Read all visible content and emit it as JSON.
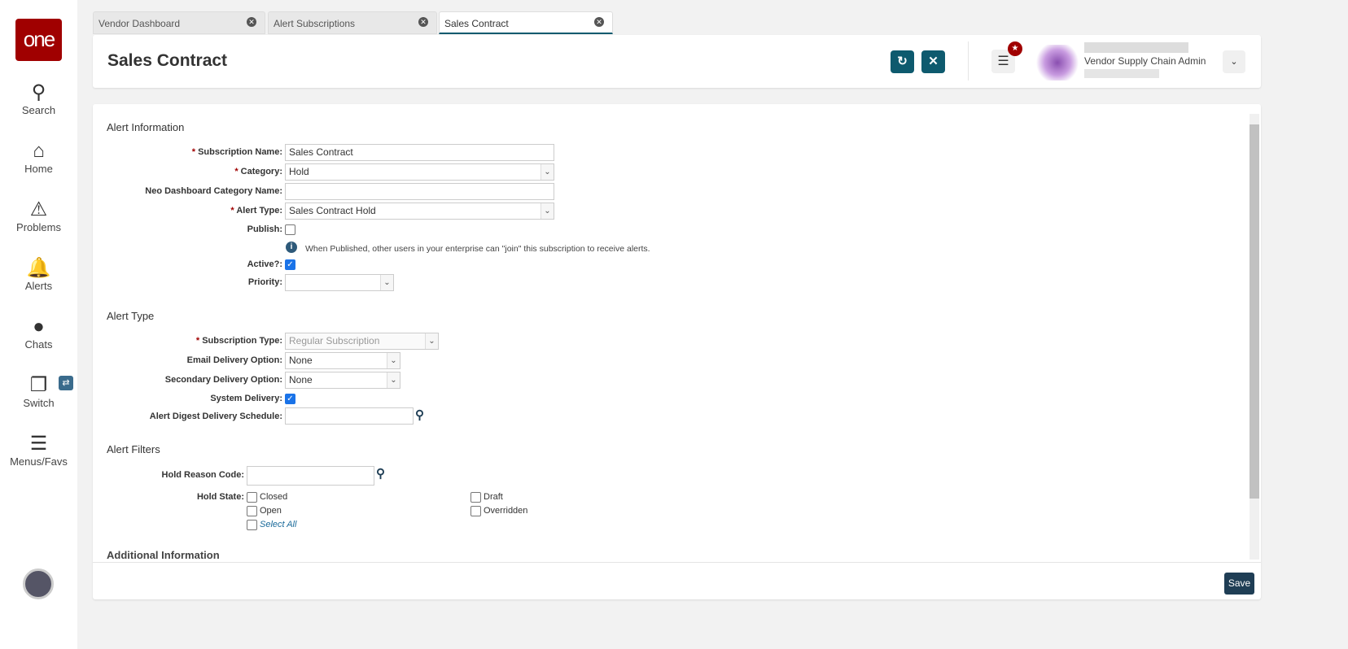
{
  "sidebar": {
    "logo": "one",
    "items": [
      {
        "label": "Search",
        "icon": "search-icon"
      },
      {
        "label": "Home",
        "icon": "home-icon"
      },
      {
        "label": "Problems",
        "icon": "warning-icon"
      },
      {
        "label": "Alerts",
        "icon": "bell-icon"
      },
      {
        "label": "Chats",
        "icon": "chat-icon"
      },
      {
        "label": "Switch",
        "icon": "switch-icon"
      },
      {
        "label": "Menus/Favs",
        "icon": "menu-icon"
      }
    ]
  },
  "tabs": [
    {
      "label": "Vendor Dashboard"
    },
    {
      "label": "Alert Subscriptions"
    },
    {
      "label": "Sales Contract",
      "active": true
    }
  ],
  "header": {
    "title": "Sales Contract",
    "user_role": "Vendor Supply Chain Admin"
  },
  "sections": {
    "alert_info": "Alert Information",
    "alert_type": "Alert Type",
    "alert_filters": "Alert Filters",
    "additional": "Additional Information"
  },
  "form": {
    "subscription_name": {
      "label": "Subscription Name:",
      "value": "Sales Contract"
    },
    "category": {
      "label": "Category:",
      "value": "Hold"
    },
    "neo_category": {
      "label": "Neo Dashboard Category Name:",
      "value": ""
    },
    "alert_type": {
      "label": "Alert Type:",
      "value": "Sales Contract Hold"
    },
    "publish": {
      "label": "Publish:",
      "checked": false
    },
    "publish_info": "When Published, other users in your enterprise can \"join\" this subscription to receive alerts.",
    "active": {
      "label": "Active?:",
      "checked": true
    },
    "priority": {
      "label": "Priority:",
      "value": ""
    },
    "subscription_type": {
      "label": "Subscription Type:",
      "value": "Regular Subscription"
    },
    "email_delivery": {
      "label": "Email Delivery Option:",
      "value": "None"
    },
    "secondary_delivery": {
      "label": "Secondary Delivery Option:",
      "value": "None"
    },
    "system_delivery": {
      "label": "System Delivery:",
      "checked": true
    },
    "digest_schedule": {
      "label": "Alert Digest Delivery Schedule:",
      "value": ""
    },
    "hold_reason_code": {
      "label": "Hold Reason Code:",
      "value": ""
    },
    "hold_state": {
      "label": "Hold State:",
      "options": [
        "Closed",
        "Draft",
        "Open",
        "Overridden"
      ],
      "select_all": "Select All"
    }
  },
  "footer": {
    "save": "Save"
  },
  "colors": {
    "brand": "#a00000",
    "accent": "#0e5a6e"
  }
}
